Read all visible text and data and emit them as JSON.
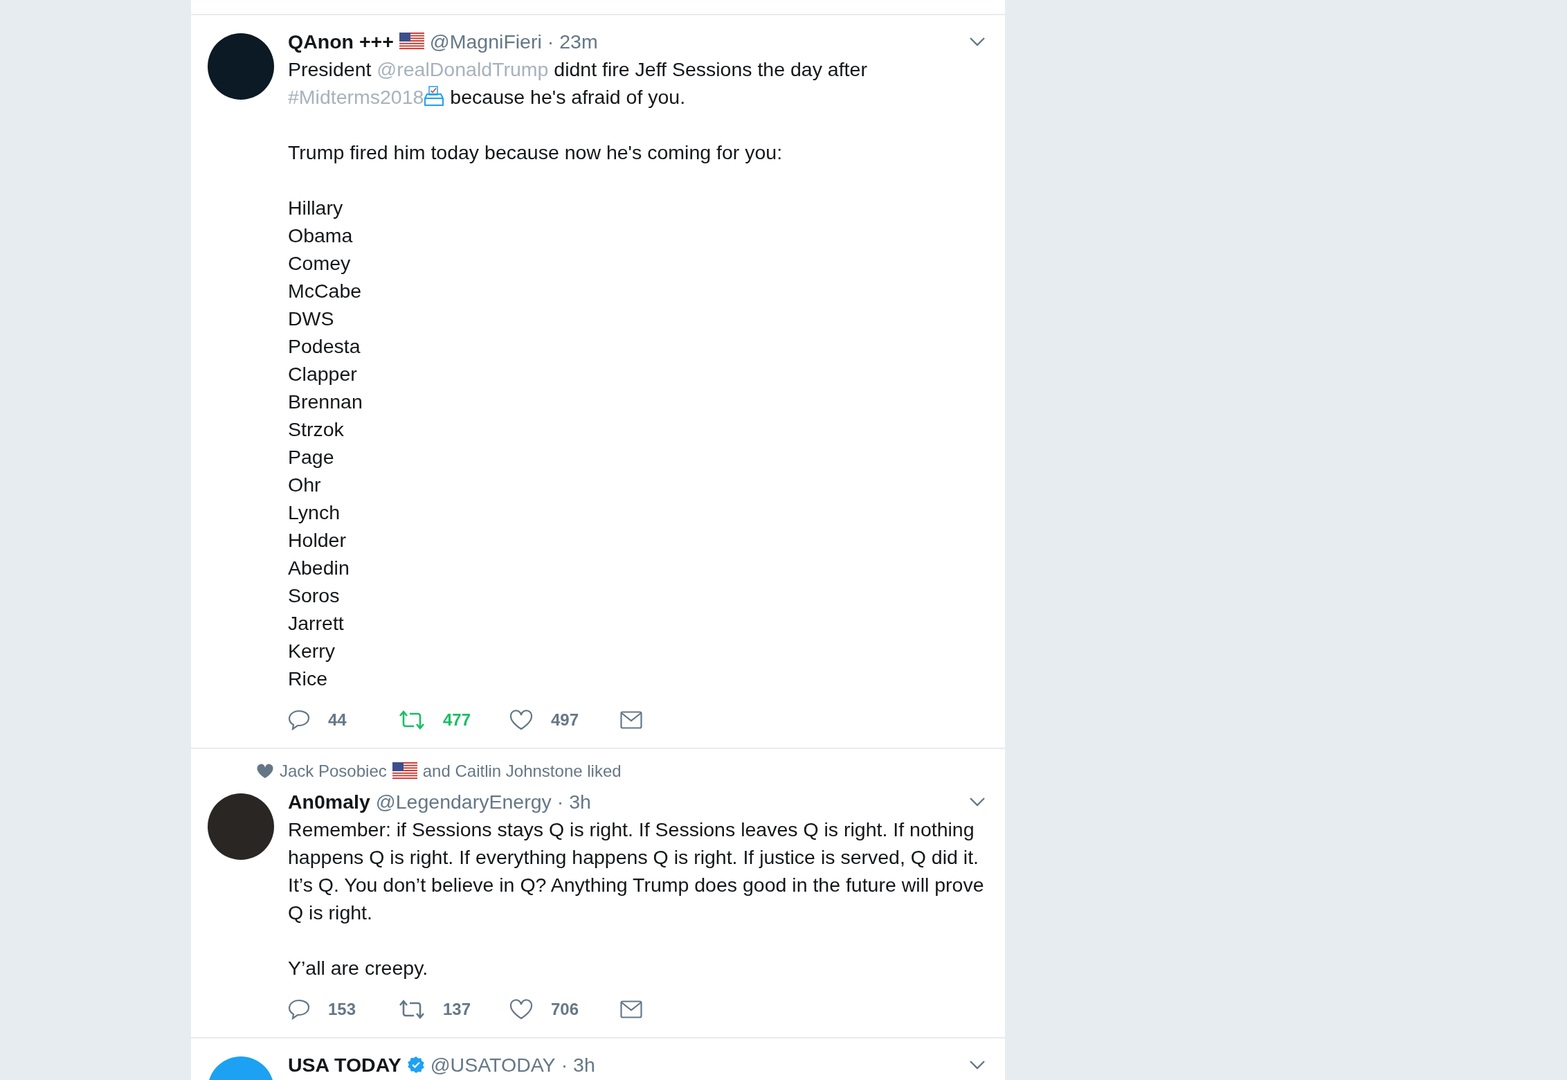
{
  "tweets": [
    {
      "avatar": {
        "color": "#0b1a24"
      },
      "name": "QAnon +++",
      "flag": true,
      "verified": false,
      "handle": "@MagniFieri",
      "time": "· 23m",
      "body": [
        {
          "segments": [
            {
              "kind": "text",
              "text": "President "
            },
            {
              "kind": "mention",
              "text": "@realDonaldTrump"
            },
            {
              "kind": "text",
              "text": " didnt fire Jeff Sessions the day after "
            },
            {
              "kind": "hashtag",
              "text": "#Midterms2018"
            },
            {
              "kind": "ballot"
            },
            {
              "kind": "text",
              "text": " because he's afraid of you."
            }
          ]
        },
        {
          "segments": [
            {
              "kind": "text",
              "text": "Trump fired him today because now he's coming for you:"
            }
          ]
        },
        {
          "lines": [
            "Hillary",
            "Obama",
            "Comey",
            "McCabe",
            "DWS",
            "Podesta",
            "Clapper",
            "Brennan",
            "Strzok",
            "Page",
            "Ohr",
            "Lynch",
            "Holder",
            "Abedin",
            "Soros",
            "Jarrett",
            "Kerry",
            "Rice"
          ]
        }
      ],
      "actions": [
        {
          "kind": "reply",
          "count": "44"
        },
        {
          "kind": "retweet",
          "count": "477",
          "active": true
        },
        {
          "kind": "like",
          "count": "497",
          "active": false
        },
        {
          "kind": "message"
        }
      ]
    },
    {
      "context": [
        {
          "kind": "text",
          "text": "Jack Posobiec"
        },
        {
          "kind": "flag"
        },
        {
          "kind": "text",
          "text": "and Caitlin Johnstone liked"
        }
      ],
      "avatar": {
        "color": "#2a2624"
      },
      "name": "An0maly",
      "flag": false,
      "verified": false,
      "handle": "@LegendaryEnergy",
      "time": "· 3h",
      "body": [
        {
          "segments": [
            {
              "kind": "text",
              "text": "Remember: if Sessions stays Q is right. If Sessions leaves Q is right. If nothing happens Q is right. If everything happens Q is right. If justice is served, Q did it. It’s Q. You don’t believe in Q? Anything Trump does good in the future will prove Q is right."
            }
          ]
        },
        {
          "segments": [
            {
              "kind": "text",
              "text": "Y’all are creepy."
            }
          ]
        }
      ],
      "actions": [
        {
          "kind": "reply",
          "count": "153"
        },
        {
          "kind": "retweet",
          "count": "137",
          "active": false
        },
        {
          "kind": "like",
          "count": "706",
          "active": false
        },
        {
          "kind": "message"
        }
      ]
    },
    {
      "avatar": {
        "color": "#1da1f2"
      },
      "name": "USA TODAY",
      "flag": false,
      "verified": true,
      "handle": "@USATODAY",
      "time": "· 3h"
    }
  ]
}
